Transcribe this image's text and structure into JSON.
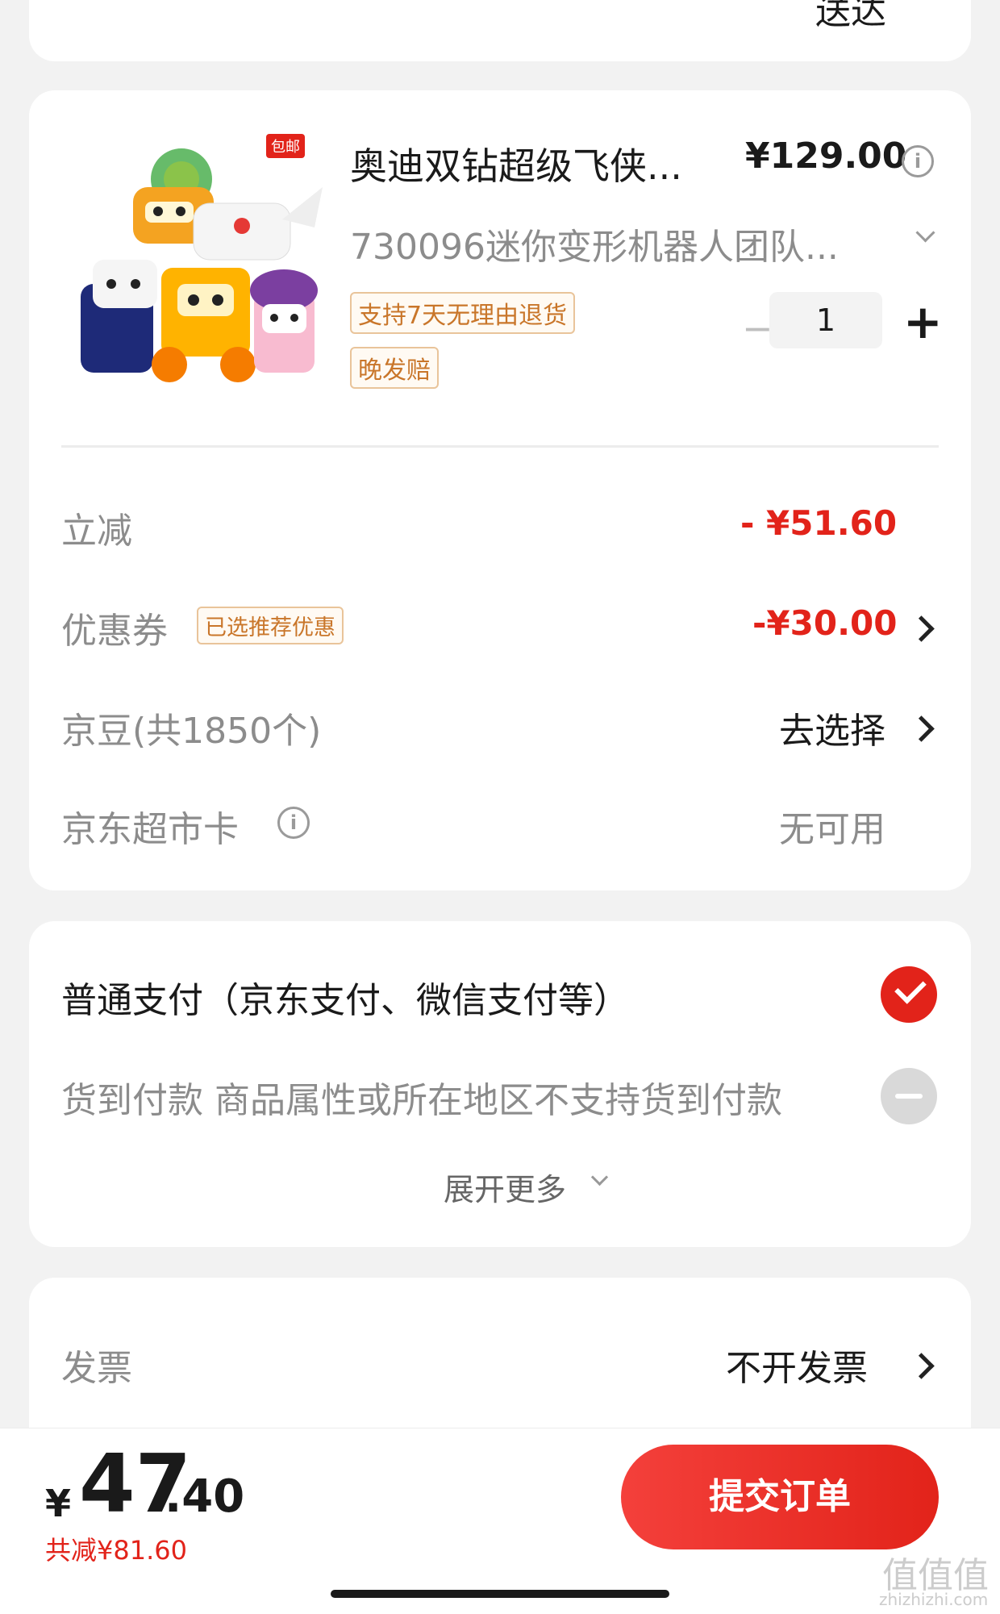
{
  "top_partial": {
    "text": "送达"
  },
  "product": {
    "badge": "包邮",
    "title": "奥迪双钻超级飞侠...",
    "price": "¥129.00",
    "spec": "730096迷你变形机器人团队...",
    "tags": [
      "支持7天无理由退货",
      "晚发赔"
    ],
    "quantity": "1",
    "minus": "−",
    "plus": "+"
  },
  "discounts": {
    "instant_label": "立减",
    "instant_value": "- ¥51.60",
    "coupon_label": "优惠券",
    "coupon_tag": "已选推荐优惠",
    "coupon_value": "-¥30.00",
    "beans_label": "京豆(共1850个)",
    "beans_value": "去选择",
    "card_label": "京东超市卡",
    "card_value": "无可用"
  },
  "payment": {
    "normal_label": "普通支付（京东支付、微信支付等）",
    "cod_label": "货到付款 商品属性或所在地区不支持货到付款",
    "expand_label": "展开更多"
  },
  "invoice": {
    "label": "发票",
    "value": "不开发票"
  },
  "footer": {
    "currency": "¥",
    "price_int": "47",
    "price_dec": ".40",
    "saved": "共减¥81.60",
    "submit_label": "提交订单"
  },
  "watermark": {
    "text": "值值值",
    "url": "zhizhizhi.com"
  },
  "colors": {
    "accent": "#e2231a",
    "background": "#f2f2f2",
    "tag_border": "#e9c49a"
  }
}
